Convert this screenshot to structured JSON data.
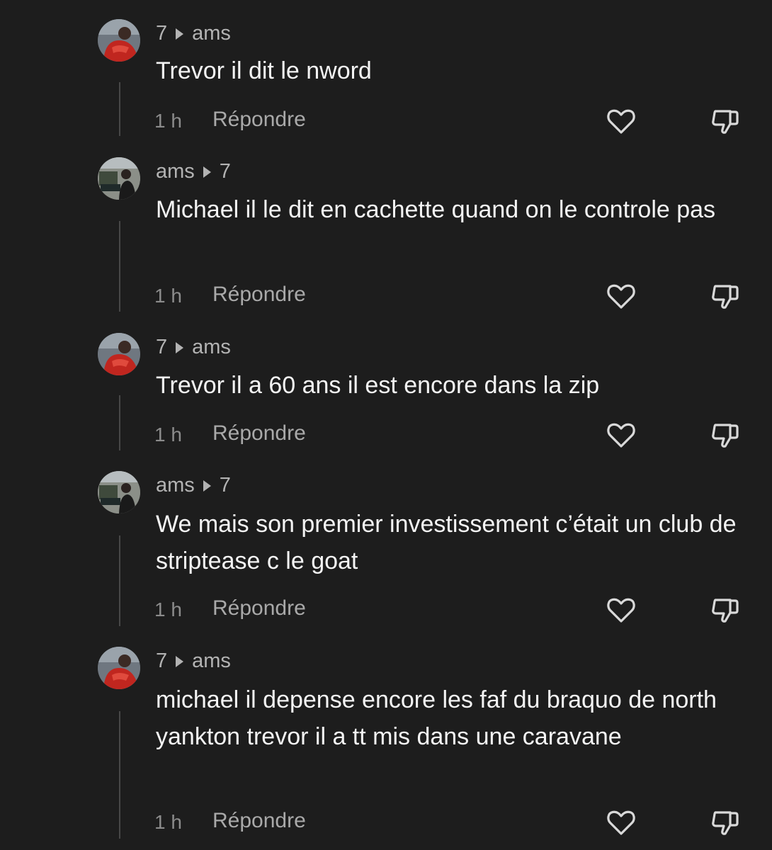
{
  "comments": [
    {
      "author": "7",
      "reply_to": "ams",
      "avatar": "red-jacket-avatar",
      "text": "Trevor il dit le nword",
      "time": "1 h",
      "reply_label": "Répondre"
    },
    {
      "author": "ams",
      "reply_to": "7",
      "avatar": "street-avatar",
      "text": "Michael il le dit en cachette quand on le controle pas",
      "time": "1 h",
      "reply_label": "Répondre"
    },
    {
      "author": "7",
      "reply_to": "ams",
      "avatar": "red-jacket-avatar",
      "text": "Trevor il a 60 ans il est encore dans la zip",
      "time": "1 h",
      "reply_label": "Répondre"
    },
    {
      "author": "ams",
      "reply_to": "7",
      "avatar": "street-avatar",
      "text": "We mais son premier investissement c’était un club de striptease c le goat",
      "time": "1 h",
      "reply_label": "Répondre"
    },
    {
      "author": "7",
      "reply_to": "ams",
      "avatar": "red-jacket-avatar",
      "text": "michael il depense encore les faf du braquo de north yankton trevor il a tt mis dans une caravane",
      "time": "1 h",
      "reply_label": "Répondre"
    }
  ],
  "icons": {
    "like": "heart-icon",
    "dislike": "thumbs-down-icon",
    "reply_arrow": "play-triangle-icon"
  },
  "colors": {
    "background": "#1d1d1d",
    "text": "#f4f4f4",
    "meta": "#b3b3b3",
    "muted": "#8c8c8c"
  }
}
